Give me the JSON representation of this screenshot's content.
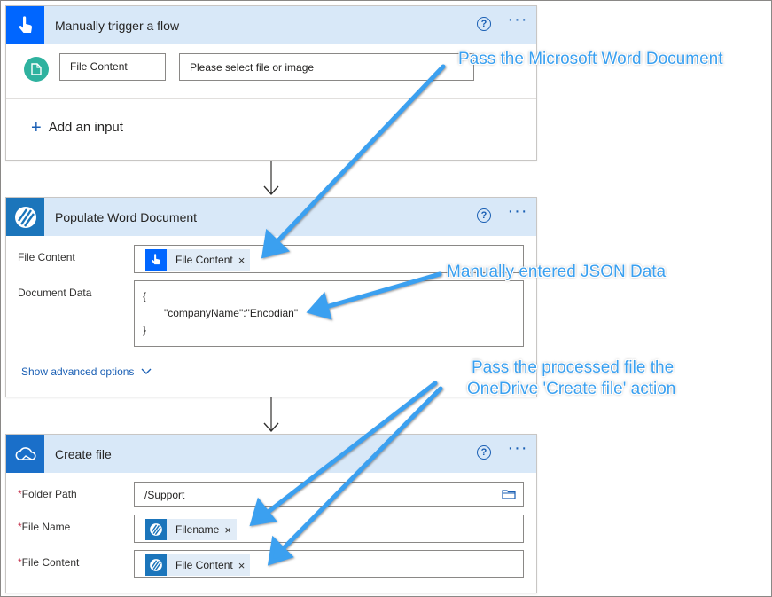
{
  "trigger": {
    "title": "Manually trigger a flow",
    "input_name": "File Content",
    "input_placeholder": "Please select file or image",
    "add_input_label": "Add an input",
    "help": "?",
    "more": "···"
  },
  "populate": {
    "title": "Populate Word Document",
    "file_content_label": "File Content",
    "file_content_token": "File Content",
    "document_data_label": "Document Data",
    "json_lines": [
      "{",
      "\"companyName\":\"Encodian\"",
      "}"
    ],
    "show_advanced": "Show advanced options",
    "help": "?",
    "more": "···"
  },
  "create_file": {
    "title": "Create file",
    "folder_path_label": "Folder Path",
    "folder_path_value": "/Support",
    "file_name_label": "File Name",
    "file_name_token": "Filename",
    "file_content_label": "File Content",
    "file_content_token": "File Content",
    "required_mark": "*",
    "help": "?",
    "more": "···"
  },
  "annotations": {
    "pass_word": "Pass the Microsoft Word Document",
    "json_data": "Manually entered JSON Data",
    "pass_processed_line1": "Pass the processed file the",
    "pass_processed_line2": "OneDrive 'Create file' action"
  },
  "token_close": "×",
  "colors": {
    "header_bg": "#d8e8f8",
    "trigger_icon": "#0066ff",
    "encodian_icon": "#1b75bb",
    "onedrive_icon": "#1a6fc9",
    "annotation": "#3aa0f0",
    "required": "#c4314b",
    "link": "#1a5fb4"
  }
}
